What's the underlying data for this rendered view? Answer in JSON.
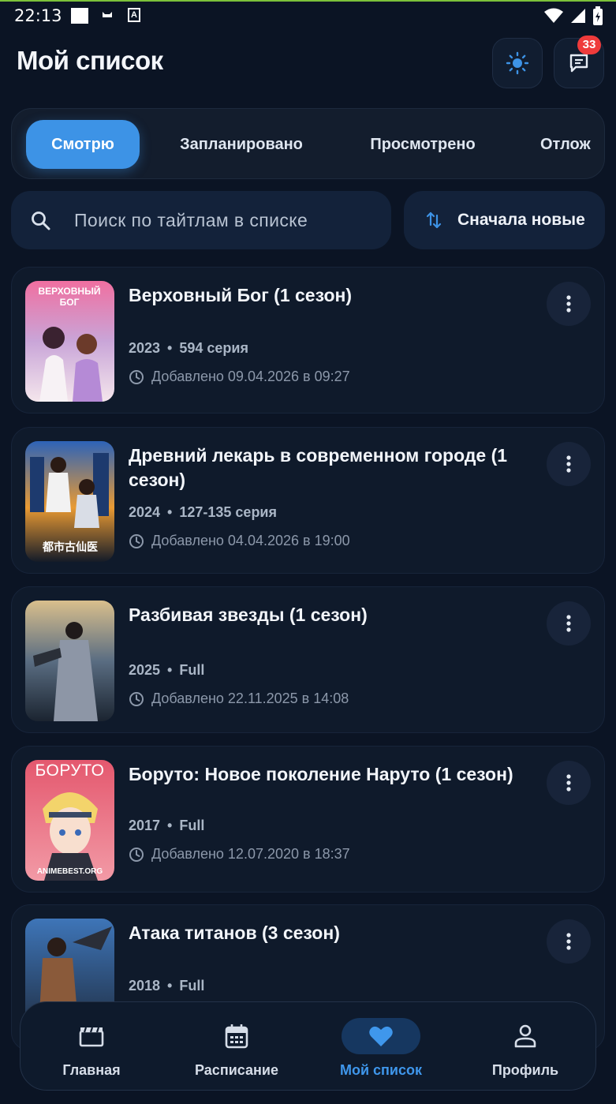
{
  "status_bar": {
    "time": "22:13",
    "a_icon_text": "A"
  },
  "header": {
    "title": "Мой список",
    "notifications_count": "33"
  },
  "tabs": [
    {
      "label": "Смотрю",
      "active": true
    },
    {
      "label": "Запланировано",
      "active": false
    },
    {
      "label": "Просмотрено",
      "active": false
    },
    {
      "label": "Отлож",
      "active": false
    }
  ],
  "search": {
    "placeholder": "Поиск по тайтлам в списке"
  },
  "sort": {
    "label": "Сначала новые"
  },
  "items": [
    {
      "title": "Верховный Бог (1 сезон)",
      "year": "2023",
      "episodes": "594 серия",
      "added": "Добавлено 09.04.2026 в 09:27",
      "poster_text": "ВЕРХОВНЫЙ БОГ",
      "poster_colors": [
        "#f4b9d2",
        "#9c6bb8",
        "#f6e3ea"
      ]
    },
    {
      "title": "Древний лекарь в современном городе (1 сезон)",
      "year": "2024",
      "episodes": "127-135 серия",
      "added": "Добавлено 04.04.2026 в 19:00",
      "poster_text": "都市古仙医",
      "poster_colors": [
        "#2a5aa8",
        "#e8932a",
        "#101826"
      ]
    },
    {
      "title": "Разбивая звезды (1 сезон)",
      "year": "2025",
      "episodes": "Full",
      "added": "Добавлено 22.11.2025 в 14:08",
      "poster_text": "",
      "poster_colors": [
        "#c7a878",
        "#3e4f63",
        "#1c2532"
      ]
    },
    {
      "title": "Боруто: Новое поколение Наруто (1 сезон)",
      "year": "2017",
      "episodes": "Full",
      "added": "Добавлено 12.07.2020 в 18:37",
      "poster_text": "БОРУТО",
      "poster_caption": "ANIMEBEST.ORG",
      "poster_colors": [
        "#e76b7d",
        "#f3d77a",
        "#f6a0a8"
      ]
    },
    {
      "title": "Атака титанов (3 сезон)",
      "year": "2018",
      "episodes": "Full",
      "poster_text": "",
      "poster_colors": [
        "#4a78b8",
        "#2a3648",
        "#8a5a3a"
      ]
    }
  ],
  "bottom_nav": [
    {
      "label": "Главная",
      "icon": "clapperboard-icon",
      "active": false
    },
    {
      "label": "Расписание",
      "icon": "calendar-icon",
      "active": false
    },
    {
      "label": "Мой список",
      "icon": "heart-icon",
      "active": true
    },
    {
      "label": "Профиль",
      "icon": "person-icon",
      "active": false
    }
  ],
  "colors": {
    "background": "#0b1424",
    "accent": "#3d93e6",
    "badge": "#ef3b3b",
    "card": "#0f1a2b"
  }
}
